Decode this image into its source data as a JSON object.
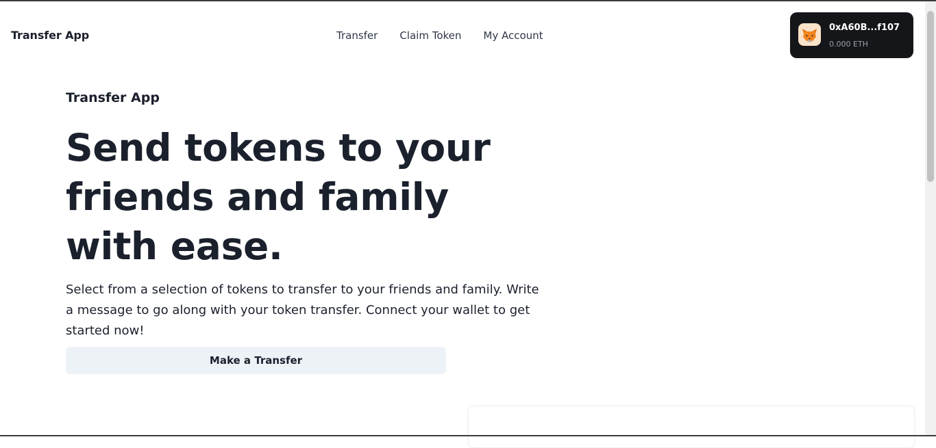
{
  "navbar": {
    "brand": "Transfer App",
    "links": [
      {
        "label": "Transfer"
      },
      {
        "label": "Claim Token"
      },
      {
        "label": "My Account"
      }
    ]
  },
  "wallet": {
    "icon": "metamask-fox-icon",
    "address": "0xA60B...f107",
    "balance": "0.000 ETH"
  },
  "hero": {
    "eyebrow": "Transfer App",
    "headline": "Send tokens to your friends and family with ease.",
    "description": "Select from a selection of tokens to transfer to your friends and family. Write a message to go along with your token transfer. Connect your wallet to get started now!",
    "cta_label": "Make a Transfer"
  },
  "colors": {
    "text": "#1a202c",
    "wallet_bg": "#15161a",
    "cta_bg": "#edf2f7"
  }
}
